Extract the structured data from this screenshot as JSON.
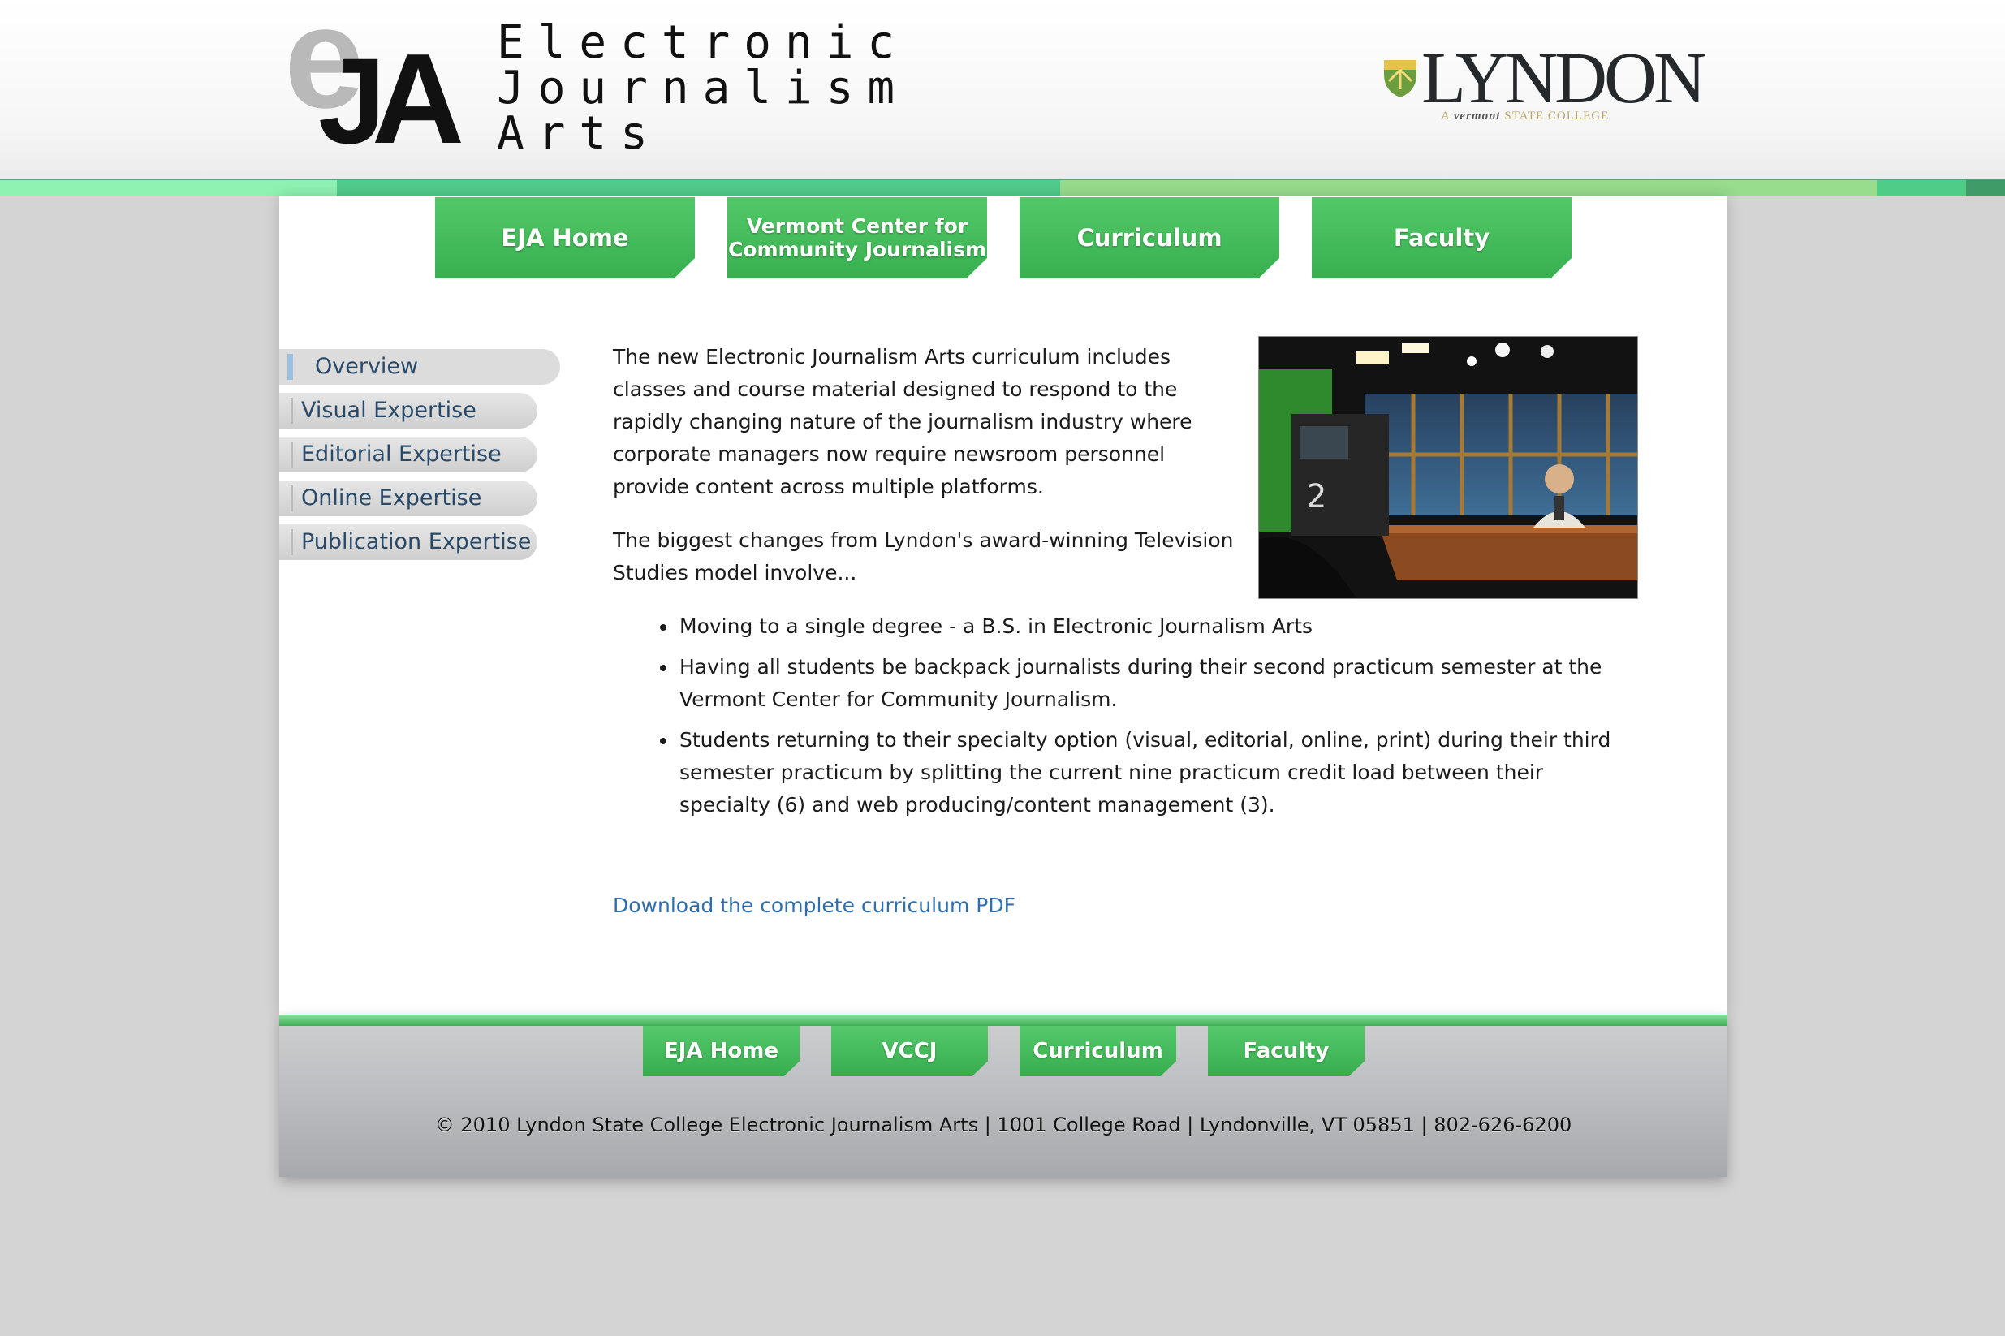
{
  "header": {
    "logo_mark": "eJA",
    "logo_line1": "Electronic",
    "logo_line2": "Journalism",
    "logo_line3": "Arts",
    "college_name": "LYNDON",
    "college_tagline_prefix": "A",
    "college_tagline_state": "vermont",
    "college_tagline_suffix": "STATE COLLEGE"
  },
  "nav": {
    "tabs": [
      {
        "label": "EJA Home"
      },
      {
        "label_line1": "Vermont Center for",
        "label_line2": "Community Journalism"
      },
      {
        "label": "Curriculum"
      },
      {
        "label": "Faculty"
      }
    ]
  },
  "sidebar": {
    "items": [
      {
        "label": "Overview",
        "active": true
      },
      {
        "label": "Visual Expertise"
      },
      {
        "label": "Editorial Expertise"
      },
      {
        "label": "Online Expertise"
      },
      {
        "label": "Publication Expertise"
      }
    ]
  },
  "content": {
    "paragraph1": "The new Electronic Journalism Arts curriculum includes classes and course material designed to respond to the rapidly changing nature of the journalism industry where corporate managers now require newsroom personnel provide content across multiple platforms.",
    "paragraph2": "The biggest changes from Lyndon's award-winning Television Studies model involve...",
    "bullets": [
      "Moving to a single degree - a B.S. in Electronic Journalism Arts",
      "Having all students be backpack journalists during their second practicum semester at the Vermont Center for Community Journalism.",
      "Students returning to their specialty option (visual, editorial, online, print) during their third semester practicum by splitting the current nine practicum credit load between their specialty (6) and web producing/content management (3)."
    ],
    "download_link": "Download the complete curriculum PDF",
    "image_camera_number": "2"
  },
  "footer": {
    "tabs": [
      "EJA Home",
      "VCCJ",
      "Curriculum",
      "Faculty"
    ],
    "copyright": "© 2010 Lyndon State College Electronic Journalism Arts | 1001 College Road | Lyndonville, VT 05851 | 802-626-6200"
  },
  "colors": {
    "nav_green": "#3fb957",
    "link_blue": "#2f6fae",
    "sidebar_text": "#284a68",
    "page_bg": "#d4d4d4"
  }
}
